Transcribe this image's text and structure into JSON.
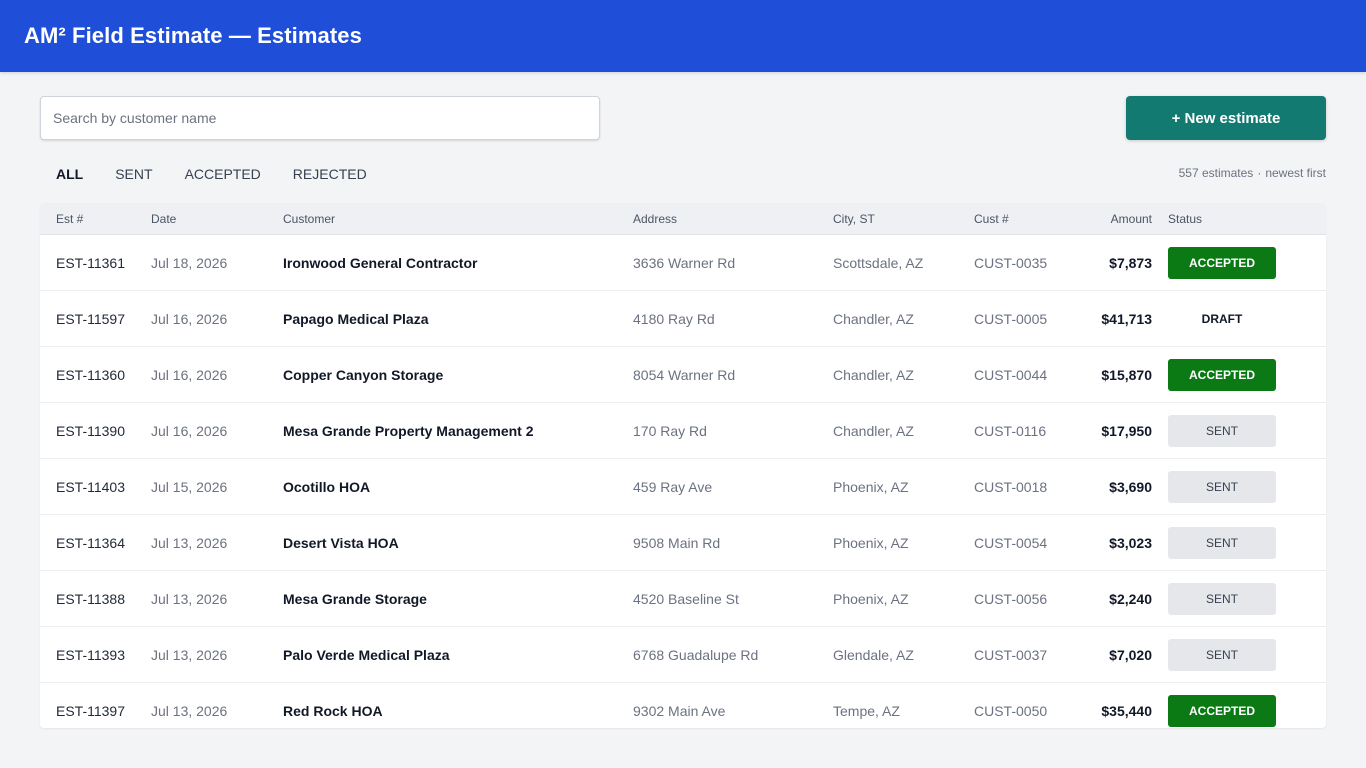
{
  "app_bar": {
    "title": "AM² Field Estimate — Estimates",
    "color": "#1f4fd8"
  },
  "search": {
    "placeholder": "Search by customer name",
    "value": ""
  },
  "new_button": {
    "label": "+ New estimate",
    "color": "#137a72"
  },
  "filters": {
    "tabs": [
      {
        "label": "ALL",
        "active": true
      },
      {
        "label": "SENT",
        "active": false
      },
      {
        "label": "ACCEPTED",
        "active": false
      },
      {
        "label": "REJECTED",
        "active": false
      }
    ]
  },
  "summary": {
    "count": "557 estimates",
    "separator": "·",
    "sort": "newest first"
  },
  "table": {
    "headers": [
      "Est #",
      "Date",
      "Customer",
      "Address",
      "City, ST",
      "Cust #",
      "Amount",
      "Status"
    ],
    "rows": [
      {
        "est": "EST-11361",
        "date": "Jul 18, 2026",
        "customer": "Ironwood General Contractor",
        "address": "3636 Warner Rd",
        "city": "Scottsdale, AZ",
        "cust_no": "CUST-0035",
        "amount": "$7,873",
        "status": "ACCEPTED"
      },
      {
        "est": "EST-11597",
        "date": "Jul 16, 2026",
        "customer": "Papago Medical Plaza",
        "address": "4180 Ray Rd",
        "city": "Chandler, AZ",
        "cust_no": "CUST-0005",
        "amount": "$41,713",
        "status": "DRAFT"
      },
      {
        "est": "EST-11360",
        "date": "Jul 16, 2026",
        "customer": "Copper Canyon Storage",
        "address": "8054 Warner Rd",
        "city": "Chandler, AZ",
        "cust_no": "CUST-0044",
        "amount": "$15,870",
        "status": "ACCEPTED"
      },
      {
        "est": "EST-11390",
        "date": "Jul 16, 2026",
        "customer": "Mesa Grande Property Management 2",
        "address": "170 Ray Rd",
        "city": "Chandler, AZ",
        "cust_no": "CUST-0116",
        "amount": "$17,950",
        "status": "SENT"
      },
      {
        "est": "EST-11403",
        "date": "Jul 15, 2026",
        "customer": "Ocotillo HOA",
        "address": "459 Ray Ave",
        "city": "Phoenix, AZ",
        "cust_no": "CUST-0018",
        "amount": "$3,690",
        "status": "SENT"
      },
      {
        "est": "EST-11364",
        "date": "Jul 13, 2026",
        "customer": "Desert Vista HOA",
        "address": "9508 Main Rd",
        "city": "Phoenix, AZ",
        "cust_no": "CUST-0054",
        "amount": "$3,023",
        "status": "SENT"
      },
      {
        "est": "EST-11388",
        "date": "Jul 13, 2026",
        "customer": "Mesa Grande Storage",
        "address": "4520 Baseline St",
        "city": "Phoenix, AZ",
        "cust_no": "CUST-0056",
        "amount": "$2,240",
        "status": "SENT"
      },
      {
        "est": "EST-11393",
        "date": "Jul 13, 2026",
        "customer": "Palo Verde Medical Plaza",
        "address": "6768 Guadalupe Rd",
        "city": "Glendale, AZ",
        "cust_no": "CUST-0037",
        "amount": "$7,020",
        "status": "SENT"
      },
      {
        "est": "EST-11397",
        "date": "Jul 13, 2026",
        "customer": "Red Rock HOA",
        "address": "9302 Main Ave",
        "city": "Tempe, AZ",
        "cust_no": "CUST-0050",
        "amount": "$35,440",
        "status": "ACCEPTED"
      }
    ]
  },
  "status_colors": {
    "ACCEPTED": "#0b7a15",
    "SENT": "#e5e7eb",
    "DRAFT": "transparent"
  }
}
